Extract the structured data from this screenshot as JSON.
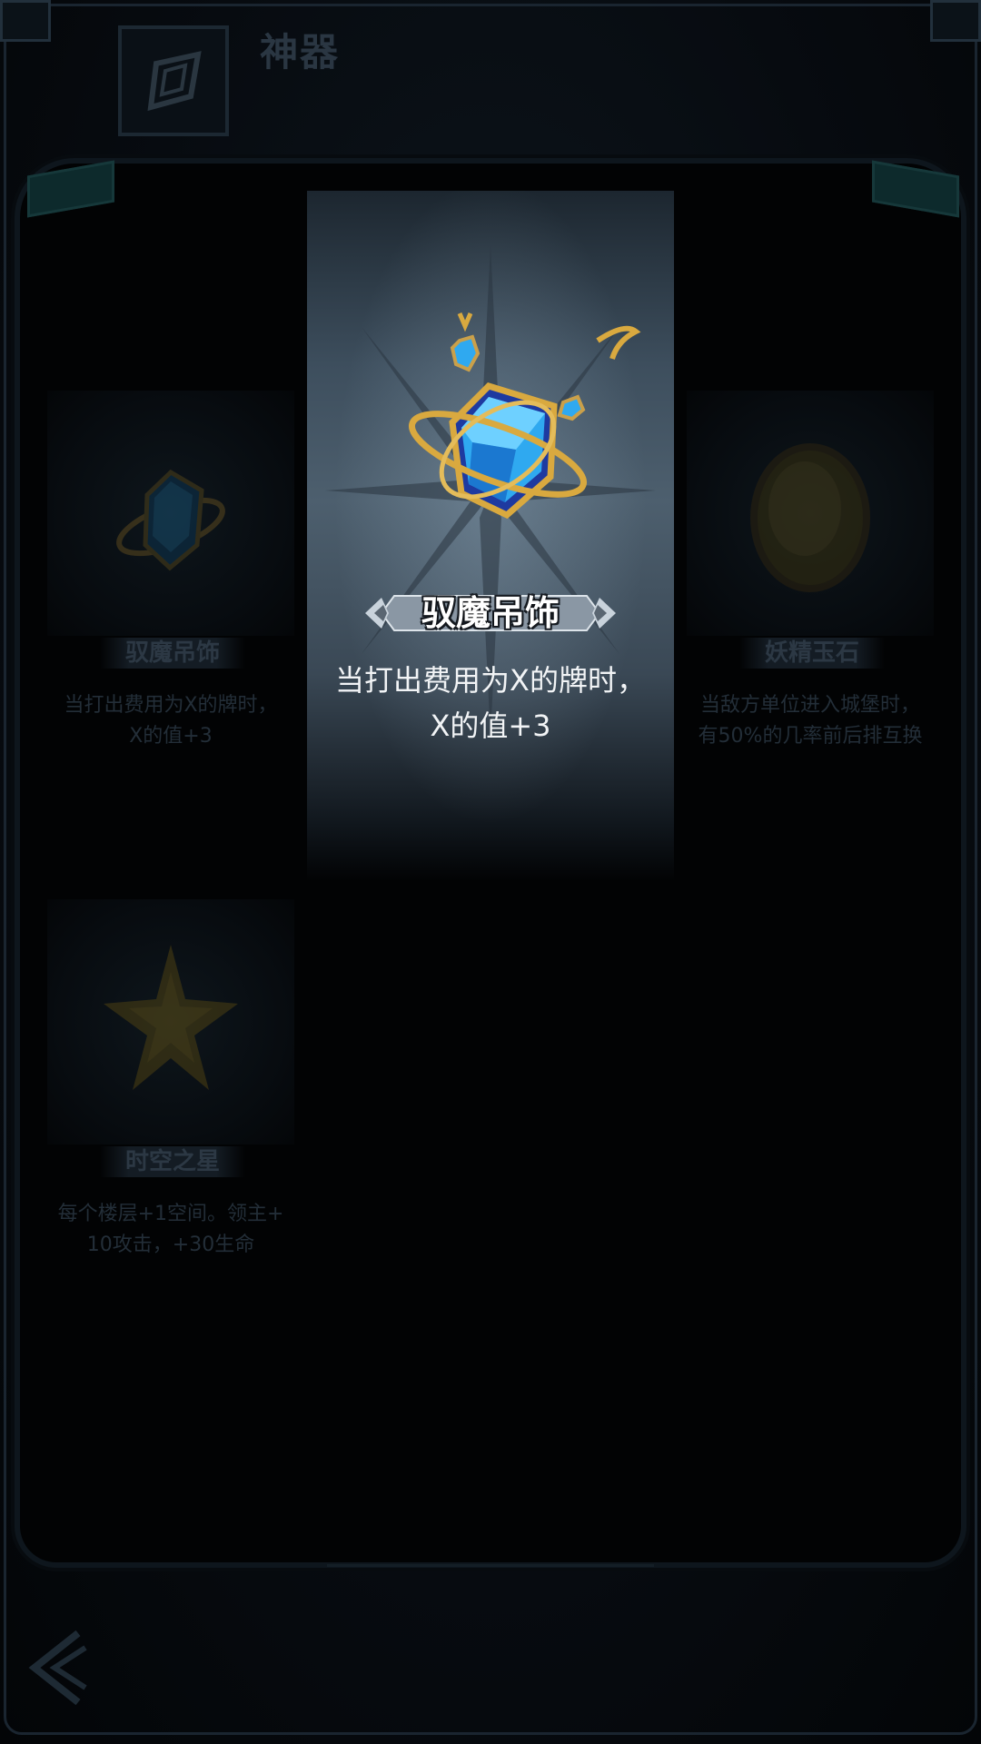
{
  "header": {
    "title": "神器",
    "icon": "artifact-emblem-icon"
  },
  "artifacts": [
    {
      "name": "驭魔吊饰",
      "description_line1": "当打出费用为X的牌时，",
      "description_line2": "X的值+3",
      "icon": "blue-crystal-pendant-icon"
    },
    {
      "name": "妖精玉石",
      "description_line1": "当敌方单位进入城堡时，",
      "description_line2": "有50%的几率前后排互换",
      "icon": "yellow-jade-stone-icon"
    },
    {
      "name": "时空之星",
      "description_line1": "每个楼层+1空间。领主+",
      "description_line2": "10攻击，+30生命",
      "icon": "golden-star-icon"
    }
  ],
  "selected": {
    "name": "驭魔吊饰",
    "description_line1": "当打出费用为X的牌时，",
    "description_line2": "X的值+3",
    "icon": "blue-crystal-pendant-icon"
  },
  "navigation": {
    "back_icon": "back-arrow-icon"
  },
  "colors": {
    "background": "#05080c",
    "highlight_card": "#4d5f6e",
    "gem_blue": "#2fa9f0",
    "gold": "#d9a93f"
  }
}
